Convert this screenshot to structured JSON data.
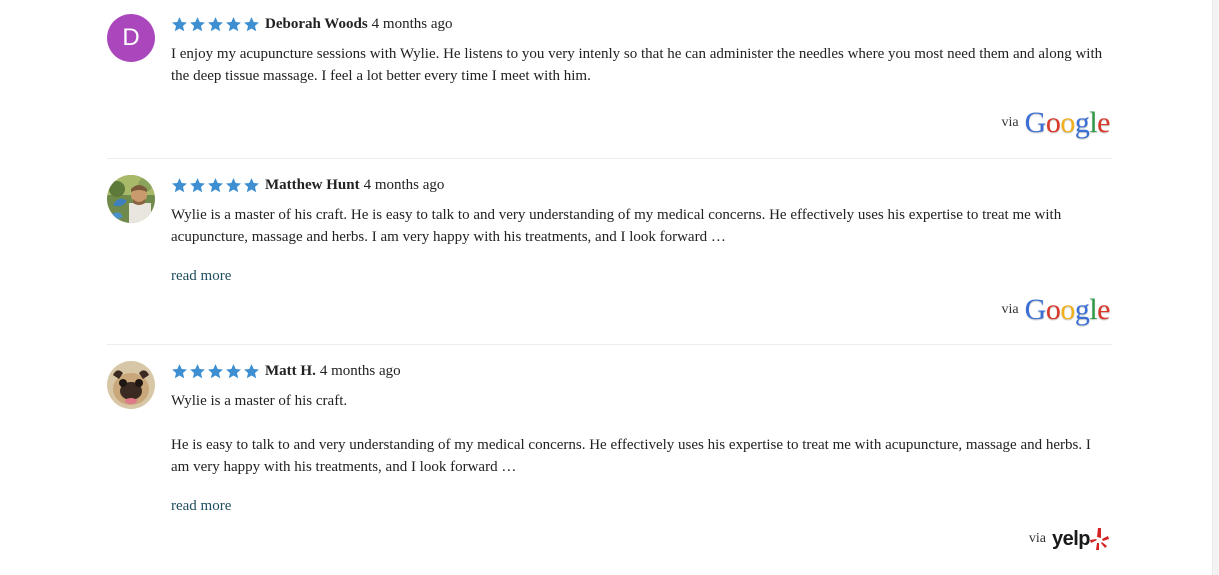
{
  "reviews": [
    {
      "author": "Deborah Woods",
      "time": "4 months ago",
      "rating": 5,
      "avatar": {
        "type": "letter",
        "letter": "D",
        "color": "#ab47bc"
      },
      "paragraphs": [
        "I enjoy my acupuncture sessions with Wylie. He listens to you very intenly so that he can administer the needles where you most need them and along with the deep tissue massage. I feel a lot better every time I meet with him."
      ],
      "read_more": null,
      "via_label": "via",
      "source": "Google"
    },
    {
      "author": "Matthew Hunt",
      "time": "4 months ago",
      "rating": 5,
      "avatar": {
        "type": "photo",
        "subject": "man outdoors"
      },
      "paragraphs": [
        "Wylie is a master of his craft. He is easy to talk to and very understanding of my medical concerns. He effectively uses his expertise to treat me with acupuncture, massage and herbs. I am very happy with his treatments, and I look forward …"
      ],
      "read_more": "read more",
      "via_label": "via",
      "source": "Google"
    },
    {
      "author": "Matt H.",
      "time": "4 months ago",
      "rating": 5,
      "avatar": {
        "type": "photo",
        "subject": "pug dog"
      },
      "paragraphs": [
        "Wylie is a master of his craft.",
        "He is easy to talk to and very understanding of my medical concerns. He effectively uses his expertise to treat me with acupuncture, massage and herbs. I am very happy with his treatments, and I look forward …"
      ],
      "read_more": "read more",
      "via_label": "via",
      "source": "yelp"
    }
  ],
  "colors": {
    "star": "#3d8fd1",
    "link": "#1e4e5e",
    "divider": "#ececec",
    "google_blue": "#3b6fd6",
    "google_red": "#d9382a",
    "google_yellow": "#f2b01e",
    "google_green": "#2f9a48",
    "yelp_red": "#d32323"
  }
}
